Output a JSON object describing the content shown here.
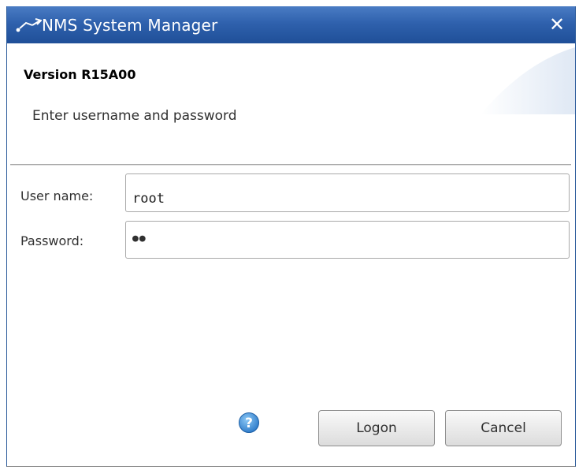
{
  "window": {
    "title": "NMS System Manager",
    "close_glyph": "✕",
    "app_icon": "arrow-path-icon"
  },
  "header": {
    "version": "Version R15A00",
    "instruction": "Enter username and password"
  },
  "form": {
    "username_label": "User name:",
    "username_value": "root",
    "password_label": "Password:",
    "password_mask": "●●"
  },
  "actions": {
    "help_icon": "question-mark-icon",
    "logon_label": "Logon",
    "cancel_label": "Cancel"
  },
  "colors": {
    "titlebar": "#2f61ad",
    "help_icon": "#3a8fd8"
  }
}
